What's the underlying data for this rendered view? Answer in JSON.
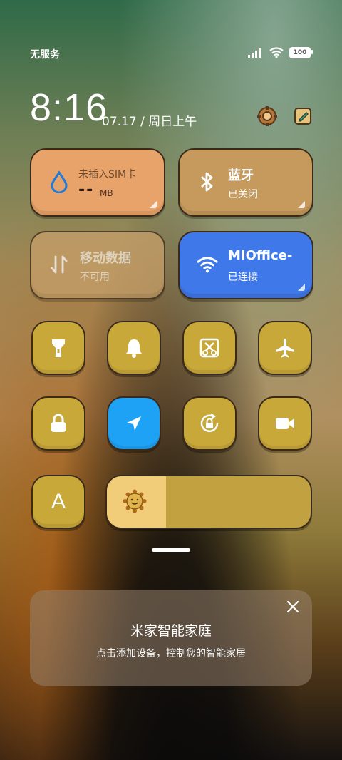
{
  "status_bar": {
    "carrier": "无服务",
    "battery": "100"
  },
  "clock": {
    "time": "8:16",
    "date": "07.17 / 周日上午"
  },
  "tiles": {
    "data_usage": {
      "title": "未插入SIM卡",
      "value": "--",
      "unit": "MB",
      "color": "#e8a36b"
    },
    "bluetooth": {
      "title": "蓝牙",
      "status": "已关闭",
      "color": "#c69a5c"
    },
    "mobile_data": {
      "title": "移动数据",
      "status": "不可用",
      "color": "#c7a06a"
    },
    "wifi": {
      "title": "MIOffice-",
      "status": "已连接",
      "color": "#3f78e8"
    }
  },
  "toggles": [
    {
      "name": "flashlight",
      "icon": "flashlight-icon",
      "active": false
    },
    {
      "name": "bell",
      "icon": "bell-icon",
      "active": false
    },
    {
      "name": "screenshot",
      "icon": "scissors-icon",
      "active": false
    },
    {
      "name": "airplane",
      "icon": "airplane-icon",
      "active": false
    },
    {
      "name": "lock",
      "icon": "lock-icon",
      "active": false
    },
    {
      "name": "location",
      "icon": "location-arrow-icon",
      "active": true,
      "color": "#1ea2f5"
    },
    {
      "name": "rotation-lock",
      "icon": "rotation-lock-icon",
      "active": false
    },
    {
      "name": "screen-record",
      "icon": "video-camera-icon",
      "active": false
    }
  ],
  "auto_brightness": {
    "label": "A"
  },
  "brightness": {
    "level": 0.29
  },
  "home_card": {
    "title": "米家智能家庭",
    "subtitle": "点击添加设备，控制您的智能家居"
  }
}
